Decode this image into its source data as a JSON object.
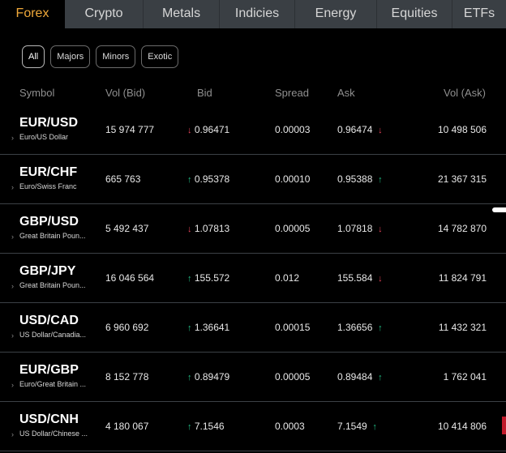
{
  "tabs": [
    {
      "label": "Forex",
      "active": true
    },
    {
      "label": "Crypto",
      "active": false
    },
    {
      "label": "Metals",
      "active": false
    },
    {
      "label": "Indicies",
      "active": false
    },
    {
      "label": "Energy",
      "active": false
    },
    {
      "label": "Equities",
      "active": false
    },
    {
      "label": "ETFs",
      "active": false
    }
  ],
  "filters": [
    {
      "label": "All",
      "active": true
    },
    {
      "label": "Majors",
      "active": false
    },
    {
      "label": "Minors",
      "active": false
    },
    {
      "label": "Exotic",
      "active": false
    }
  ],
  "columns": {
    "symbol": "Symbol",
    "vol_bid": "Vol (Bid)",
    "bid": "Bid",
    "spread": "Spread",
    "ask": "Ask",
    "vol_ask": "Vol (Ask)"
  },
  "rows": [
    {
      "code": "EUR/USD",
      "name": "Euro/US Dollar",
      "vol_bid": "15 974 777",
      "bid": "0.96471",
      "bid_dir": "down",
      "spread": "0.00003",
      "ask": "0.96474",
      "ask_dir": "down",
      "vol_ask": "10 498 506"
    },
    {
      "code": "EUR/CHF",
      "name": "Euro/Swiss Franc",
      "vol_bid": "665 763",
      "bid": "0.95378",
      "bid_dir": "up",
      "spread": "0.00010",
      "ask": "0.95388",
      "ask_dir": "up",
      "vol_ask": "21 367 315"
    },
    {
      "code": "GBP/USD",
      "name": "Great Britain Poun...",
      "vol_bid": "5 492 437",
      "bid": "1.07813",
      "bid_dir": "down",
      "spread": "0.00005",
      "ask": "1.07818",
      "ask_dir": "down",
      "vol_ask": "14 782 870"
    },
    {
      "code": "GBP/JPY",
      "name": "Great Britain Poun...",
      "vol_bid": "16 046 564",
      "bid": "155.572",
      "bid_dir": "up",
      "spread": "0.012",
      "ask": "155.584",
      "ask_dir": "down",
      "vol_ask": "11 824 791"
    },
    {
      "code": "USD/CAD",
      "name": "US Dollar/Canadia...",
      "vol_bid": "6 960 692",
      "bid": "1.36641",
      "bid_dir": "up",
      "spread": "0.00015",
      "ask": "1.36656",
      "ask_dir": "up",
      "vol_ask": "11 432 321"
    },
    {
      "code": "EUR/GBP",
      "name": "Euro/Great Britain ...",
      "vol_bid": "8 152 778",
      "bid": "0.89479",
      "bid_dir": "up",
      "spread": "0.00005",
      "ask": "0.89484",
      "ask_dir": "up",
      "vol_ask": "1 762 041"
    },
    {
      "code": "USD/CNH",
      "name": "US Dollar/Chinese ...",
      "vol_bid": "4 180 067",
      "bid": "7.1546",
      "bid_dir": "up",
      "spread": "0.0003",
      "ask": "7.1549",
      "ask_dir": "up",
      "vol_ask": "10 414 806"
    }
  ],
  "icons": {
    "up": "↑",
    "down": "↓",
    "chevron": "›"
  },
  "colors": {
    "active_tab": "#f0a93a",
    "up": "#22c087",
    "down": "#e8435a",
    "tab_bar": "#3a3f44"
  }
}
